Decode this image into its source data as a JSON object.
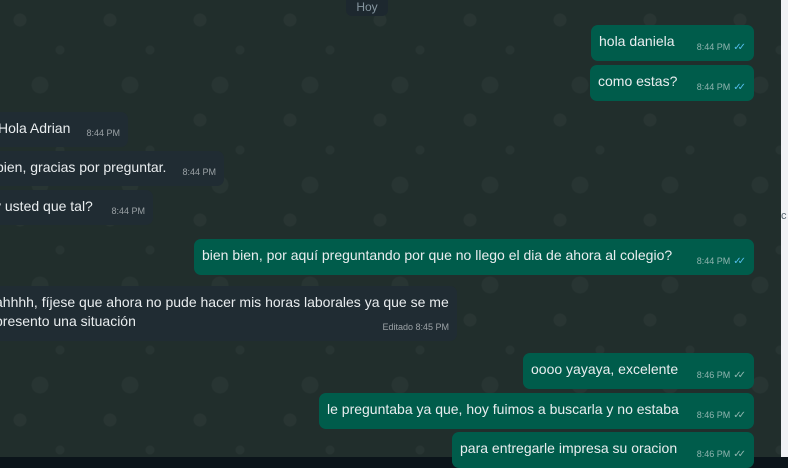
{
  "chat": {
    "date_label": "Hoy",
    "messages": [
      {
        "text": "hola daniela",
        "time": "8:44 PM",
        "ticks": "✓✓"
      },
      {
        "text": "como estas?",
        "time": "8:44 PM",
        "ticks": "✓✓"
      },
      {
        "text": "Hola Adrian",
        "time": "8:44 PM"
      },
      {
        "text": "bien, gracias por preguntar.",
        "time": "8:44 PM"
      },
      {
        "text": "y usted que tal?",
        "time": "8:44 PM"
      },
      {
        "text": "bien bien, por aquí preguntando por que no llego el dia de ahora al colegio?",
        "time": "8:44 PM",
        "ticks": "✓✓"
      },
      {
        "line1": "ahhhh, fíjese que ahora no pude hacer mis horas laborales ya que se me",
        "line2": "presento una situación",
        "time": "Editado 8:45 PM"
      },
      {
        "text": "oooo yayaya, excelente",
        "time": "8:46 PM",
        "ticks": "✓✓"
      },
      {
        "text": "le preguntaba ya que, hoy fuimos a buscarla y no estaba",
        "time": "8:46 PM",
        "ticks": "✓✓"
      },
      {
        "text": "para entregarle impresa su oracion",
        "time": "8:46 PM",
        "ticks": "✓✓"
      }
    ]
  },
  "rail": {
    "glyph": "c"
  },
  "colors": {
    "outgoing": "#005c4b",
    "incoming": "#202c33",
    "read_ticks": "#53bdeb",
    "background": "#212e2c"
  }
}
